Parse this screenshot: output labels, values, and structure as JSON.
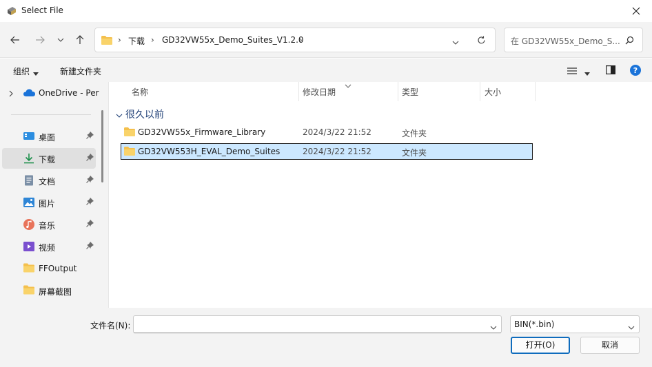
{
  "window": {
    "title": "Select File"
  },
  "nav": {
    "breadcrumbs": [
      "下载",
      "GD32VW55x_Demo_Suites_V1.2.0"
    ],
    "search_placeholder": "在 GD32VW55x_Demo_S..."
  },
  "toolbar": {
    "organize": "组织",
    "new_folder": "新建文件夹"
  },
  "sidebar": {
    "onedrive": "OneDrive - Per",
    "items": [
      {
        "label": "桌面",
        "icon": "desktop-icon",
        "pinned": true
      },
      {
        "label": "下载",
        "icon": "download-icon",
        "pinned": true,
        "active": true
      },
      {
        "label": "文档",
        "icon": "document-icon",
        "pinned": true
      },
      {
        "label": "图片",
        "icon": "pictures-icon",
        "pinned": true
      },
      {
        "label": "音乐",
        "icon": "music-icon",
        "pinned": true
      },
      {
        "label": "视频",
        "icon": "video-icon",
        "pinned": true
      },
      {
        "label": "FFOutput",
        "icon": "folder-icon",
        "pinned": false
      },
      {
        "label": "屏幕截图",
        "icon": "folder-icon",
        "pinned": false
      }
    ]
  },
  "columns": {
    "name": "名称",
    "modified": "修改日期",
    "type": "类型",
    "size": "大小"
  },
  "group": {
    "label": "很久以前"
  },
  "files": [
    {
      "name": "GD32VW55x_Firmware_Library",
      "modified": "2024/3/22 21:52",
      "type": "文件夹",
      "selected": false
    },
    {
      "name": "GD32VW553H_EVAL_Demo_Suites",
      "modified": "2024/3/22 21:52",
      "type": "文件夹",
      "selected": true
    }
  ],
  "footer": {
    "filename_label": "文件名(N):",
    "filename_value": "",
    "filetype_value": "BIN(*.bin)",
    "open_label": "打开(O)",
    "cancel_label": "取消"
  },
  "colors": {
    "accent": "#0f6cbd",
    "selection": "#cce8ff",
    "folder": "#f4c04d"
  }
}
